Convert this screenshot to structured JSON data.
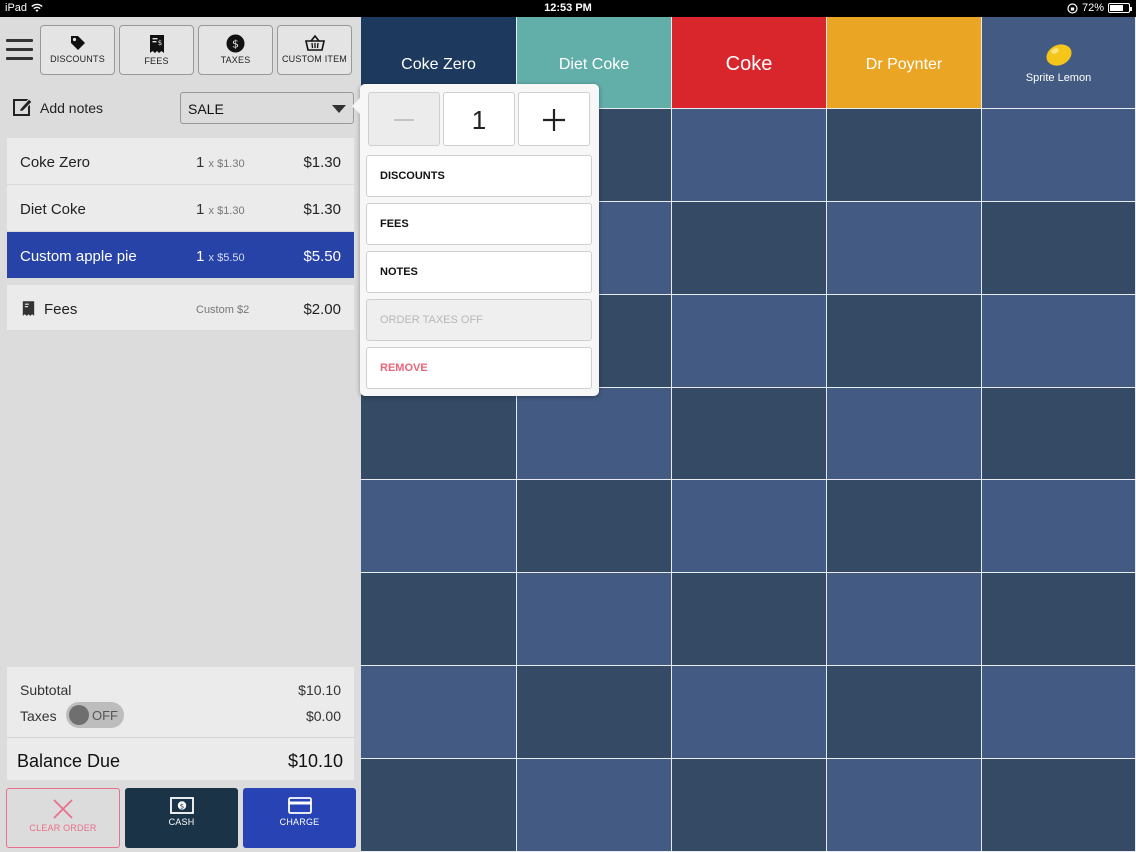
{
  "status_bar": {
    "device": "iPad",
    "time": "12:53 PM",
    "battery": "72%",
    "battery_level": 0.72
  },
  "toolbar": {
    "buttons": [
      {
        "label": "DISCOUNTS",
        "icon": "tag-icon"
      },
      {
        "label": "FEES",
        "icon": "receipt-icon"
      },
      {
        "label": "TAXES",
        "icon": "dollar-coin-icon"
      },
      {
        "label": "CUSTOM ITEM",
        "icon": "basket-icon"
      }
    ]
  },
  "order": {
    "notes_label": "Add notes",
    "order_type": "SALE",
    "items": [
      {
        "name": "Coke Zero",
        "qty": "1",
        "unit": "x $1.30",
        "price": "$1.30",
        "selected": false
      },
      {
        "name": "Diet Coke",
        "qty": "1",
        "unit": "x $1.30",
        "price": "$1.30",
        "selected": false
      },
      {
        "name": "Custom apple pie",
        "qty": "1",
        "unit": "x $5.50",
        "price": "$5.50",
        "selected": true
      }
    ],
    "fee": {
      "name": "Fees",
      "detail": "Custom $2",
      "price": "$2.00"
    }
  },
  "totals": {
    "subtotal_label": "Subtotal",
    "subtotal": "$10.10",
    "taxes_label": "Taxes",
    "taxes_toggle": "OFF",
    "taxes": "$0.00",
    "balance_label": "Balance Due",
    "balance": "$10.10"
  },
  "actions": {
    "clear": "CLEAR ORDER",
    "cash": "CASH",
    "charge": "CHARGE"
  },
  "popover": {
    "quantity": "1",
    "items": [
      {
        "label": "DISCOUNTS",
        "state": "normal"
      },
      {
        "label": "FEES",
        "state": "normal"
      },
      {
        "label": "NOTES",
        "state": "normal"
      },
      {
        "label": "ORDER TAXES OFF",
        "state": "disabled"
      },
      {
        "label": "REMOVE",
        "state": "danger"
      }
    ]
  },
  "products": [
    {
      "name": "Coke Zero",
      "color": "#1d3a5e",
      "text_color": "#ffffff"
    },
    {
      "name": "Diet Coke",
      "color": "#62aea9",
      "text_color": "#ffffff"
    },
    {
      "name": "Coke",
      "color": "#d9262c",
      "text_color": "#ffffff"
    },
    {
      "name": "Dr Poynter",
      "color": "#eba525",
      "text_color": "#ffffff"
    },
    {
      "name": "Sprite Lemon",
      "color": "#435a82",
      "text_color": "#ffffff",
      "icon": "lemon-icon"
    }
  ],
  "colors": {
    "grid_dark": "#354a65",
    "grid_light": "#435a82",
    "accent_blue": "#2743a8",
    "cash": "#1b3347",
    "danger": "#e8708a"
  }
}
